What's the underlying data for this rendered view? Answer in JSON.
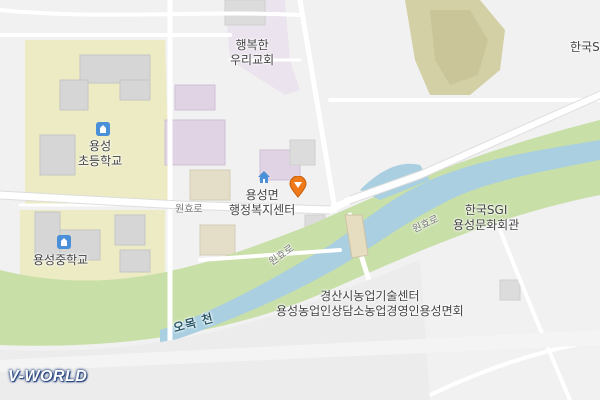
{
  "poi": {
    "church": {
      "line1": "행복한",
      "line2": "우리교회"
    },
    "elem_school": {
      "line1": "용성",
      "line2": "초등학교"
    },
    "middle_school": {
      "label": "용성중학교"
    },
    "welfare_center": {
      "line1": "용성면",
      "line2": "행정복지센터"
    },
    "sgi_hall": {
      "line1": "한국SGI",
      "line2": "용성문화회관"
    },
    "agri_center": {
      "line1": "경산시농업기술센터",
      "line2": "용성농업인상담소농업경영인용성면회"
    },
    "top_right_partial": {
      "label": "한국S"
    }
  },
  "roads": {
    "road1": "원효로",
    "road2": "원효로",
    "road3": "원효로"
  },
  "river": {
    "name": "오목 천"
  },
  "brand": {
    "logo": "V-WORLD"
  },
  "colors": {
    "background": "#f1f1f1",
    "road": "#ffffff",
    "river": "#a9cfe0",
    "riverbank": "#c9dfa8",
    "school_area": "#ecebc2",
    "forest": "#d2cfa4",
    "building": "#dcdcdc",
    "church_area": "#e7dfe9",
    "pin": "#f07a1a",
    "poi_icon": "#4a90d9"
  },
  "icons": [
    "school-icon",
    "home-icon",
    "location-pin-icon"
  ]
}
